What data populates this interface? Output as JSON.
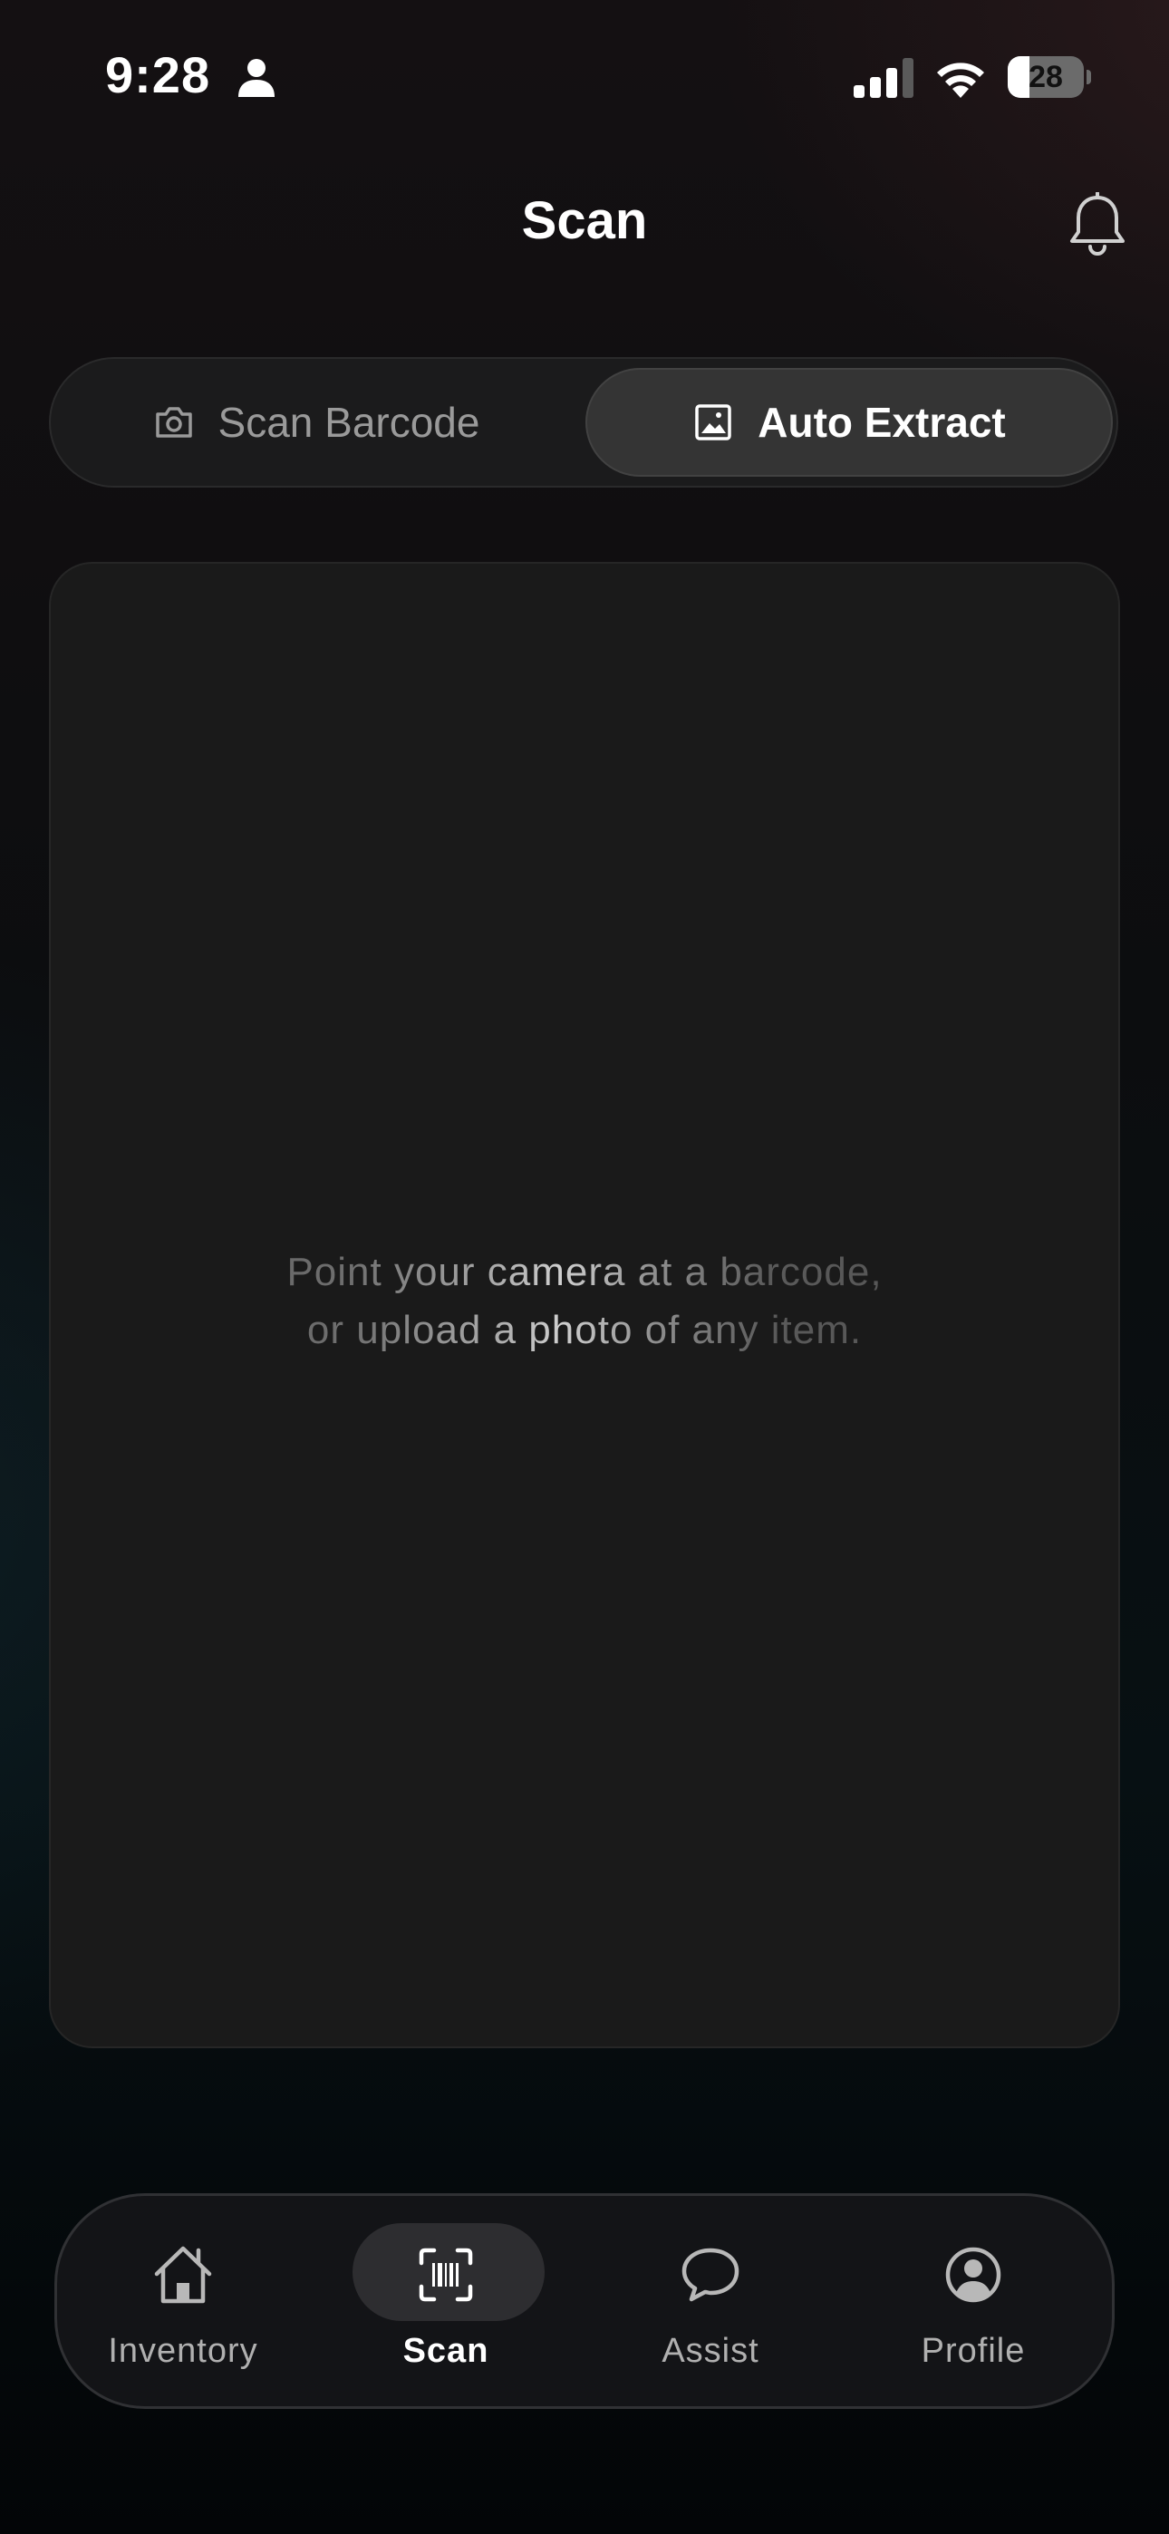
{
  "status_bar": {
    "time": "9:28",
    "battery_level": "28",
    "battery_fraction": 0.28
  },
  "header": {
    "title": "Scan"
  },
  "mode_toggle": {
    "options": [
      {
        "label": "Scan Barcode",
        "icon": "camera-icon",
        "selected": false
      },
      {
        "label": "Auto Extract",
        "icon": "image-icon",
        "selected": true
      }
    ]
  },
  "preview": {
    "hint_line1": "Point your camera at a barcode,",
    "hint_line2": "or upload a photo of any item."
  },
  "tab_bar": {
    "items": [
      {
        "label": "Inventory",
        "icon": "home-icon",
        "active": false
      },
      {
        "label": "Scan",
        "icon": "barcode-scan-icon",
        "active": true
      },
      {
        "label": "Assist",
        "icon": "chat-bubble-icon",
        "active": false
      },
      {
        "label": "Profile",
        "icon": "user-circle-icon",
        "active": false
      }
    ]
  },
  "colors": {
    "background": "#0c0d0f",
    "panel": "#1a1a1a",
    "selected_segment": "#343434",
    "text_primary": "#ffffff",
    "text_muted": "#9a9a9a"
  }
}
